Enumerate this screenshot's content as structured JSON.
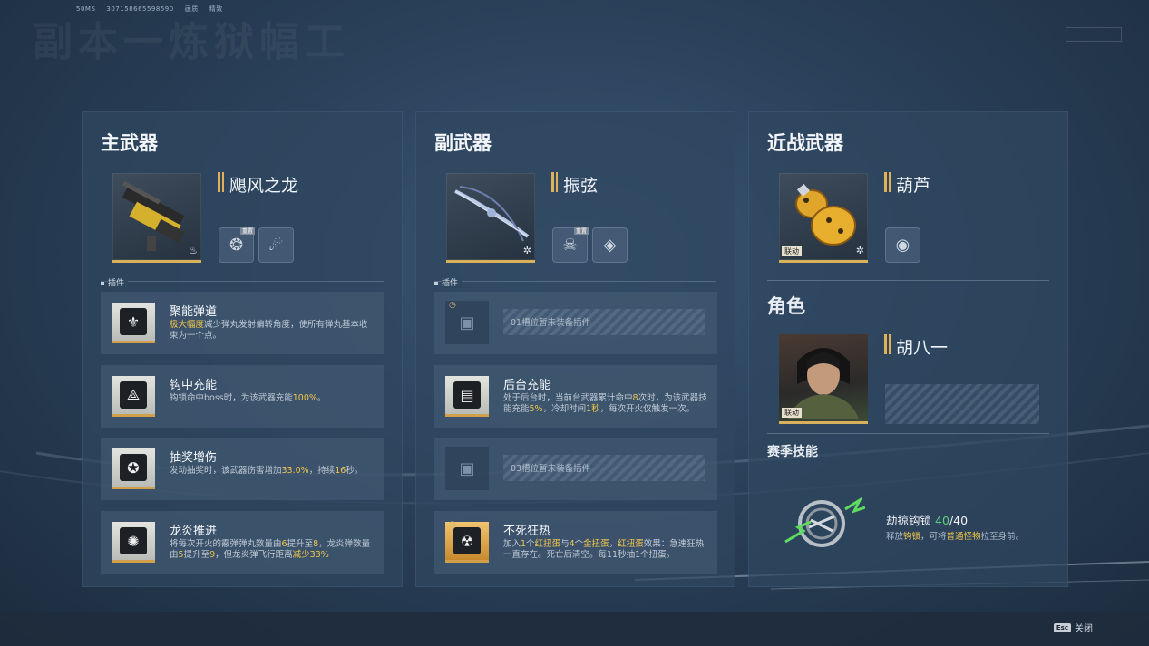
{
  "top_meta": {
    "ms": "50MS",
    "id": "307158665598590",
    "quality_label": "画质",
    "quality_value": "精致"
  },
  "bg_title": "副本一炼狱幅工",
  "primary": {
    "title": "主武器",
    "weapon_name": "飓风之龙",
    "traits": [
      {
        "icon": "beast-icon",
        "tag": "重置"
      },
      {
        "icon": "claw-icon",
        "tag": ""
      }
    ],
    "section_label": "插件",
    "mods": [
      {
        "title": "聚能弹道",
        "desc_hl": "极大幅度",
        "desc": "减少弹丸发射偏转角度，使所有弹丸基本收束为一个点。",
        "icon": "spread-icon"
      },
      {
        "title": "钩中充能",
        "desc_pre": "钩锁命中boss时，为该武器充能",
        "desc_hl": "100%",
        "desc_post": "。",
        "icon": "hook-icon"
      },
      {
        "title": "抽奖增伤",
        "desc_pre": "发动抽奖时，该武器伤害增加",
        "desc_hl": "33.0%",
        "desc_mid": "，持续",
        "desc_hl2": "16",
        "desc_post": "秒。",
        "icon": "lottery-icon"
      },
      {
        "title": "龙炎推进",
        "desc_a": "将每次开火的霰弹弹丸数量由",
        "v1": "6",
        "desc_b": "提升至",
        "v2": "8",
        "desc_c": "，龙炎弹数量由",
        "v3": "5",
        "desc_d": "提升至",
        "v4": "9",
        "desc_e": "，但龙炎弹飞行距离",
        "v5": "减少33%",
        "icon": "dragon-fire-icon"
      }
    ]
  },
  "secondary": {
    "title": "副武器",
    "weapon_name": "振弦",
    "traits": [
      {
        "icon": "skull-icon",
        "tag": "重置"
      },
      {
        "icon": "target-icon",
        "tag": ""
      }
    ],
    "section_label": "插件",
    "mods": [
      {
        "empty": true,
        "text": "01槽位暂未装备插件"
      },
      {
        "title": "后台充能",
        "desc_a": "处于后台时，当前台武器累计命中",
        "v1": "8",
        "desc_b": "次时，为该武器技能充能",
        "v2": "5%",
        "desc_c": "，冷却时间",
        "v3": "1秒",
        "desc_d": "，每次开火仅触发一次。"
      },
      {
        "empty": true,
        "text": "03槽位暂未装备插件"
      },
      {
        "title": "不死狂热",
        "desc_a": "加入",
        "v1": "1",
        "desc_b": "个",
        "v2": "红扭蛋",
        "desc_c": "与",
        "v3": "4",
        "desc_d": "个",
        "v4": "金扭蛋",
        "desc_e": "，",
        "v5": "红扭蛋",
        "desc_f": "效果：急速狂热一直存在。死亡后清空。每11秒抽1个扭蛋。"
      }
    ]
  },
  "melee": {
    "title": "近战武器",
    "weapon_name": "葫芦",
    "link_tag": "联动",
    "trait_icon": "grenade-icon"
  },
  "character": {
    "title": "角色",
    "name": "胡八一",
    "link_tag": "联动"
  },
  "season_skill": {
    "title": "赛季技能",
    "name": "劫掠钩锁",
    "count_current": "40",
    "count_total": "/40",
    "desc_a": "释放",
    "hl1": "钩锁",
    "desc_b": "，可将",
    "hl2": "普通怪物",
    "desc_c": "拉至身前。"
  },
  "footer": {
    "key": "Esc",
    "label": "关闭"
  }
}
